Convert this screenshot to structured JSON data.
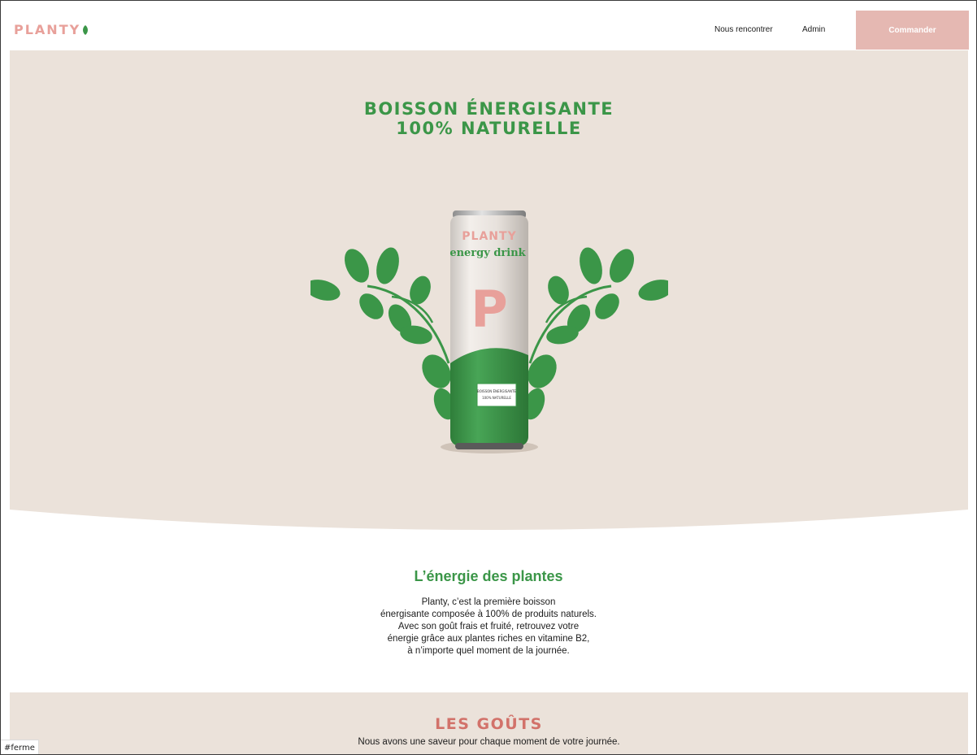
{
  "header": {
    "logo_text": "PLANTY",
    "nav": {
      "meet_label": "Nous rencontrer",
      "admin_label": "Admin"
    },
    "order_label": "Commander"
  },
  "hero": {
    "title_line1": "BOISSON ÉNERGISANTE",
    "title_line2": "100% NATURELLE",
    "can": {
      "brand": "PLANTY",
      "subtitle": "energy drink",
      "letter": "P",
      "label_line1": "BOISSON ÉNERGISANTE",
      "label_line2": "100% NATURELLE"
    }
  },
  "about": {
    "title": "L’énergie des plantes",
    "lines": [
      "Planty, c’est la première boisson",
      "énergisante composée à 100% de produits naturels.",
      "Avec son goût frais et fruité, retrouvez votre",
      "énergie grâce aux plantes riches en vitamine B2,",
      "à n’importe quel moment de la journée."
    ]
  },
  "flavors": {
    "title": "LES GOÛTS",
    "subtitle": "Nous avons une saveur pour chaque moment de votre journée."
  },
  "status_bar": {
    "url": "#ferme"
  },
  "colors": {
    "brand_pink": "#e8a09a",
    "brand_green": "#3b9648",
    "beige": "#ebe2da",
    "button_pink": "#e5b8b2",
    "flavor_title": "#d2726a"
  },
  "icons": {
    "logo_leaf": "leaf-icon"
  }
}
